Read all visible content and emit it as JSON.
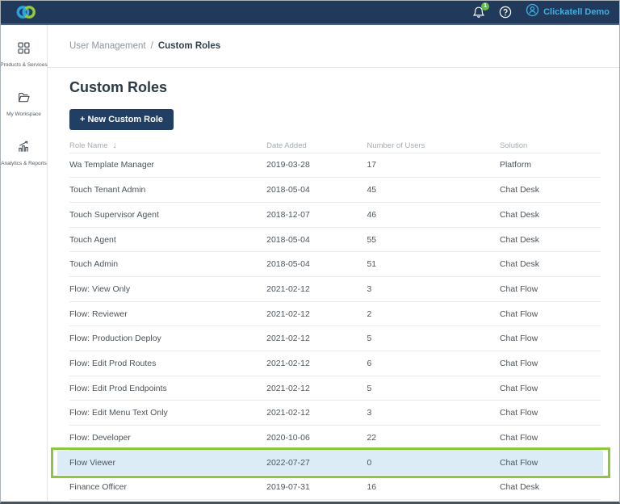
{
  "colors": {
    "topbar_bg": "#213a5c",
    "accent_blue": "#41aee4",
    "logo_blue": "#2ba3dc",
    "logo_green": "#97c93d",
    "badge_green": "#63bb46",
    "button_navy": "#213e63",
    "highlight_row_bg": "#dcecf7",
    "highlight_border_green": "#8dc63f"
  },
  "topbar": {
    "notification_count": "1",
    "user_name": "Clickatell Demo"
  },
  "sidebar": {
    "items": [
      {
        "icon": "grid-icon",
        "label": "Products & Services"
      },
      {
        "icon": "folder-icon",
        "label": "My Workspace"
      },
      {
        "icon": "bar-chart-icon",
        "label": "Analytics & Reports"
      }
    ]
  },
  "breadcrumb": {
    "parent": "User Management",
    "separator": "/",
    "current": "Custom Roles"
  },
  "page": {
    "title": "Custom Roles",
    "new_role_button": "+ New Custom Role"
  },
  "table": {
    "columns": [
      "Role Name",
      "Date Added",
      "Number of Users",
      "Solution"
    ],
    "sorted_column": "Role Name",
    "sort_icon": "↓",
    "highlighted_row_index": 12,
    "rows": [
      {
        "name": "Wa Template Manager",
        "date_added": "2019-03-28",
        "users": "17",
        "solution": "Platform"
      },
      {
        "name": "Touch Tenant Admin",
        "date_added": "2018-05-04",
        "users": "45",
        "solution": "Chat Desk"
      },
      {
        "name": "Touch Supervisor Agent",
        "date_added": "2018-12-07",
        "users": "46",
        "solution": "Chat Desk"
      },
      {
        "name": "Touch Agent",
        "date_added": "2018-05-04",
        "users": "55",
        "solution": "Chat Desk"
      },
      {
        "name": "Touch Admin",
        "date_added": "2018-05-04",
        "users": "51",
        "solution": "Chat Desk"
      },
      {
        "name": "Flow: View Only",
        "date_added": "2021-02-12",
        "users": "3",
        "solution": "Chat Flow"
      },
      {
        "name": "Flow: Reviewer",
        "date_added": "2021-02-12",
        "users": "2",
        "solution": "Chat Flow"
      },
      {
        "name": "Flow: Production Deploy",
        "date_added": "2021-02-12",
        "users": "5",
        "solution": "Chat Flow"
      },
      {
        "name": "Flow: Edit Prod Routes",
        "date_added": "2021-02-12",
        "users": "6",
        "solution": "Chat Flow"
      },
      {
        "name": "Flow: Edit Prod Endpoints",
        "date_added": "2021-02-12",
        "users": "5",
        "solution": "Chat Flow"
      },
      {
        "name": "Flow: Edit Menu Text Only",
        "date_added": "2021-02-12",
        "users": "3",
        "solution": "Chat Flow"
      },
      {
        "name": "Flow: Developer",
        "date_added": "2020-10-06",
        "users": "22",
        "solution": "Chat Flow"
      },
      {
        "name": "Flow Viewer",
        "date_added": "2022-07-27",
        "users": "0",
        "solution": "Chat Flow"
      },
      {
        "name": "Finance Officer",
        "date_added": "2019-07-31",
        "users": "16",
        "solution": "Chat Desk"
      }
    ]
  }
}
